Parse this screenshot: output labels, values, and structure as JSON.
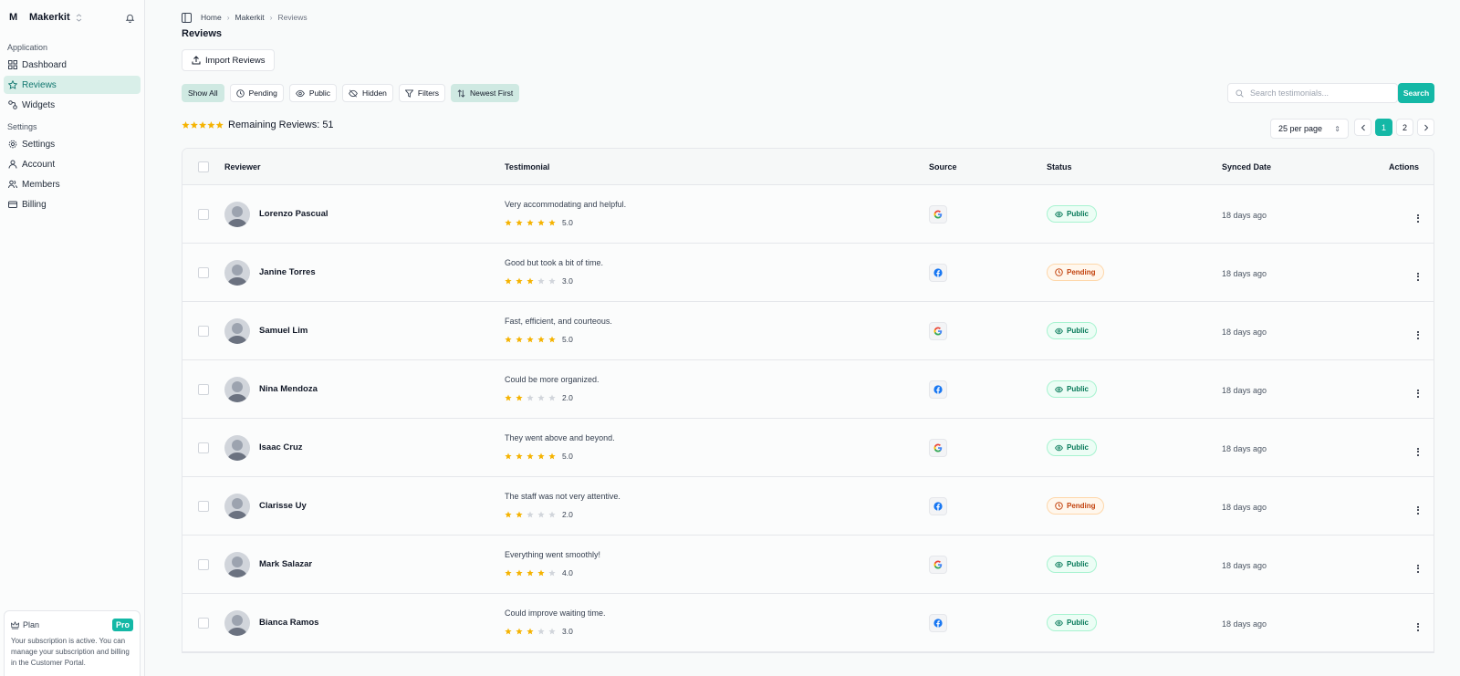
{
  "sidebar": {
    "logo": "M",
    "org": "Makerkit",
    "application_label": "Application",
    "app_items": [
      {
        "label": "Dashboard"
      },
      {
        "label": "Reviews"
      },
      {
        "label": "Widgets"
      }
    ],
    "settings_label": "Settings",
    "settings_items": [
      {
        "label": "Settings"
      },
      {
        "label": "Account"
      },
      {
        "label": "Members"
      },
      {
        "label": "Billing"
      }
    ],
    "plan": {
      "label": "Plan",
      "badge": "Pro",
      "text": "Your subscription is active. You can manage your subscription and billing in the Customer Portal."
    }
  },
  "breadcrumb": [
    "Home",
    "Makerkit",
    "Reviews"
  ],
  "page_title": "Reviews",
  "import_label": "Import Reviews",
  "filters": [
    "Show All",
    "Pending",
    "Public",
    "Hidden",
    "Filters",
    "Newest First"
  ],
  "search": {
    "placeholder": "Search testimonials...",
    "button": "Search"
  },
  "remaining": "Remaining Reviews: 51",
  "per_page": "25 per page",
  "pages": [
    "1",
    "2"
  ],
  "columns": [
    "Reviewer",
    "Testimonial",
    "Source",
    "Status",
    "Synced Date",
    "Actions"
  ],
  "rows": [
    {
      "name": "Lorenzo Pascual",
      "text": "Very accommodating and helpful.",
      "rating": 5,
      "rating_label": "5.0",
      "source": "google",
      "status": "Public",
      "date": "18 days ago"
    },
    {
      "name": "Janine Torres",
      "text": "Good but took a bit of time.",
      "rating": 3,
      "rating_label": "3.0",
      "source": "facebook",
      "status": "Pending",
      "date": "18 days ago"
    },
    {
      "name": "Samuel Lim",
      "text": "Fast, efficient, and courteous.",
      "rating": 5,
      "rating_label": "5.0",
      "source": "google",
      "status": "Public",
      "date": "18 days ago"
    },
    {
      "name": "Nina Mendoza",
      "text": "Could be more organized.",
      "rating": 2,
      "rating_label": "2.0",
      "source": "facebook",
      "status": "Public",
      "date": "18 days ago"
    },
    {
      "name": "Isaac Cruz",
      "text": "They went above and beyond.",
      "rating": 5,
      "rating_label": "5.0",
      "source": "google",
      "status": "Public",
      "date": "18 days ago"
    },
    {
      "name": "Clarisse Uy",
      "text": "The staff was not very attentive.",
      "rating": 2,
      "rating_label": "2.0",
      "source": "facebook",
      "status": "Pending",
      "date": "18 days ago"
    },
    {
      "name": "Mark Salazar",
      "text": "Everything went smoothly!",
      "rating": 4,
      "rating_label": "4.0",
      "source": "google",
      "status": "Public",
      "date": "18 days ago"
    },
    {
      "name": "Bianca Ramos",
      "text": "Could improve waiting time.",
      "rating": 3,
      "rating_label": "3.0",
      "source": "facebook",
      "status": "Public",
      "date": "18 days ago"
    }
  ],
  "colors": {
    "accent": "#14b8a6",
    "star": "#f5b301",
    "star_empty": "#d1d5db",
    "facebook": "#1877f2"
  }
}
